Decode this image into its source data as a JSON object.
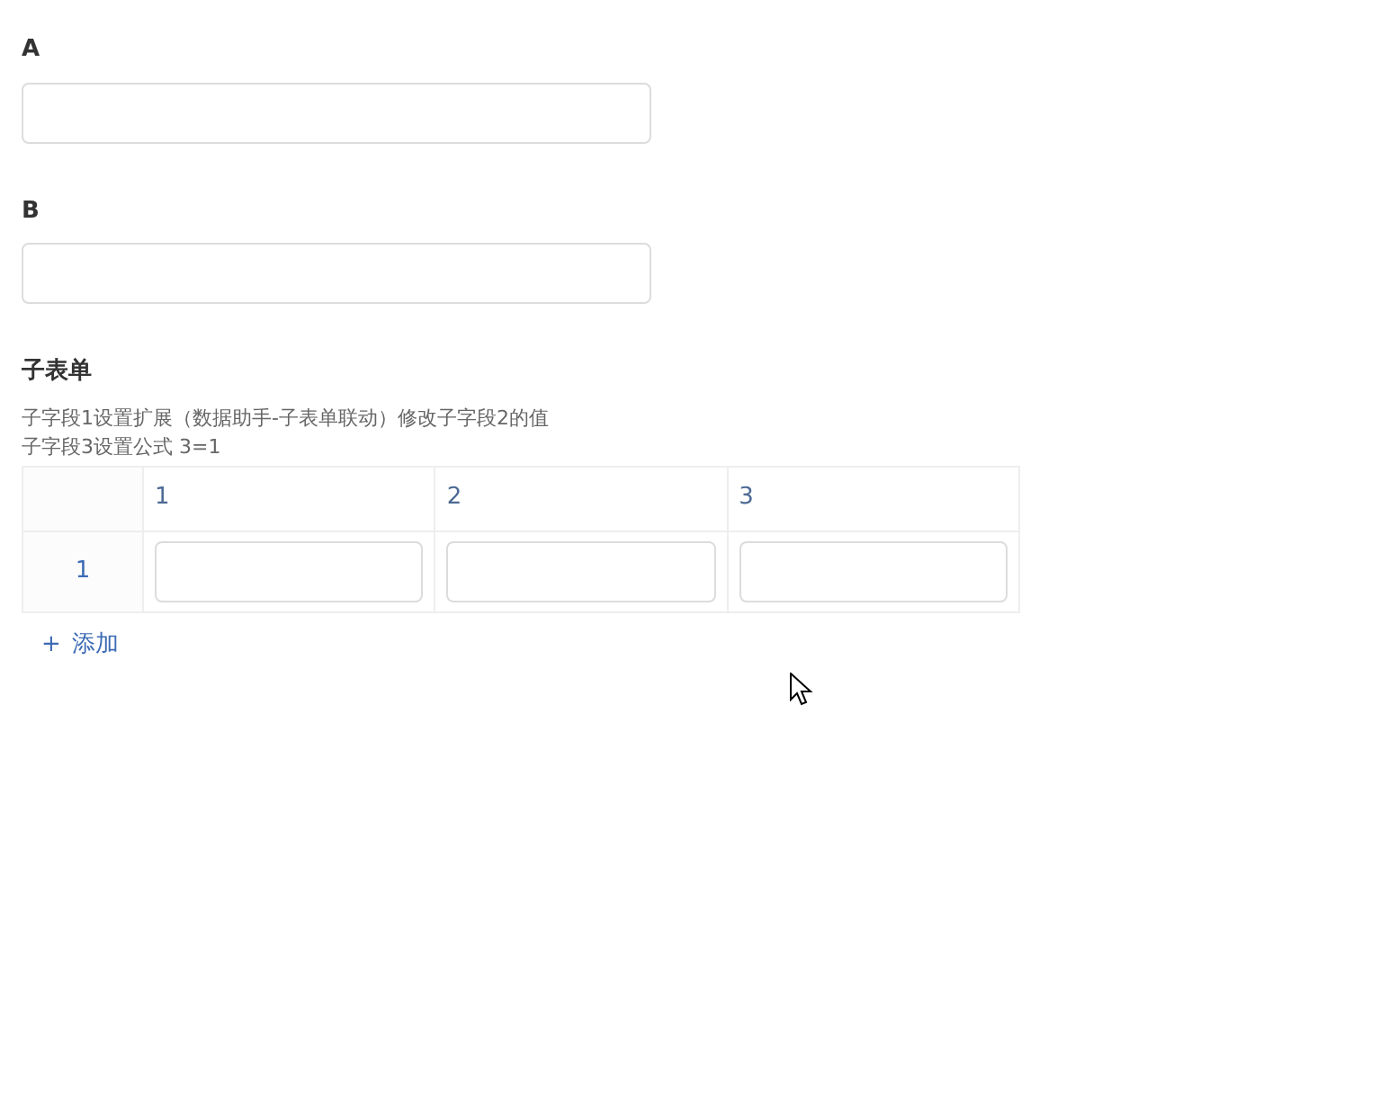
{
  "fields": [
    {
      "label": "A"
    },
    {
      "label": "B"
    }
  ],
  "subform": {
    "title": "子表单",
    "description": [
      "子字段1设置扩展（数据助手-子表单联动）修改子字段2的值",
      "子字段3设置公式 3=1"
    ],
    "columns": [
      "1",
      "2",
      "3"
    ],
    "rows": [
      {
        "number": "1"
      }
    ],
    "add_button": {
      "icon": "+",
      "label": "添加"
    }
  }
}
